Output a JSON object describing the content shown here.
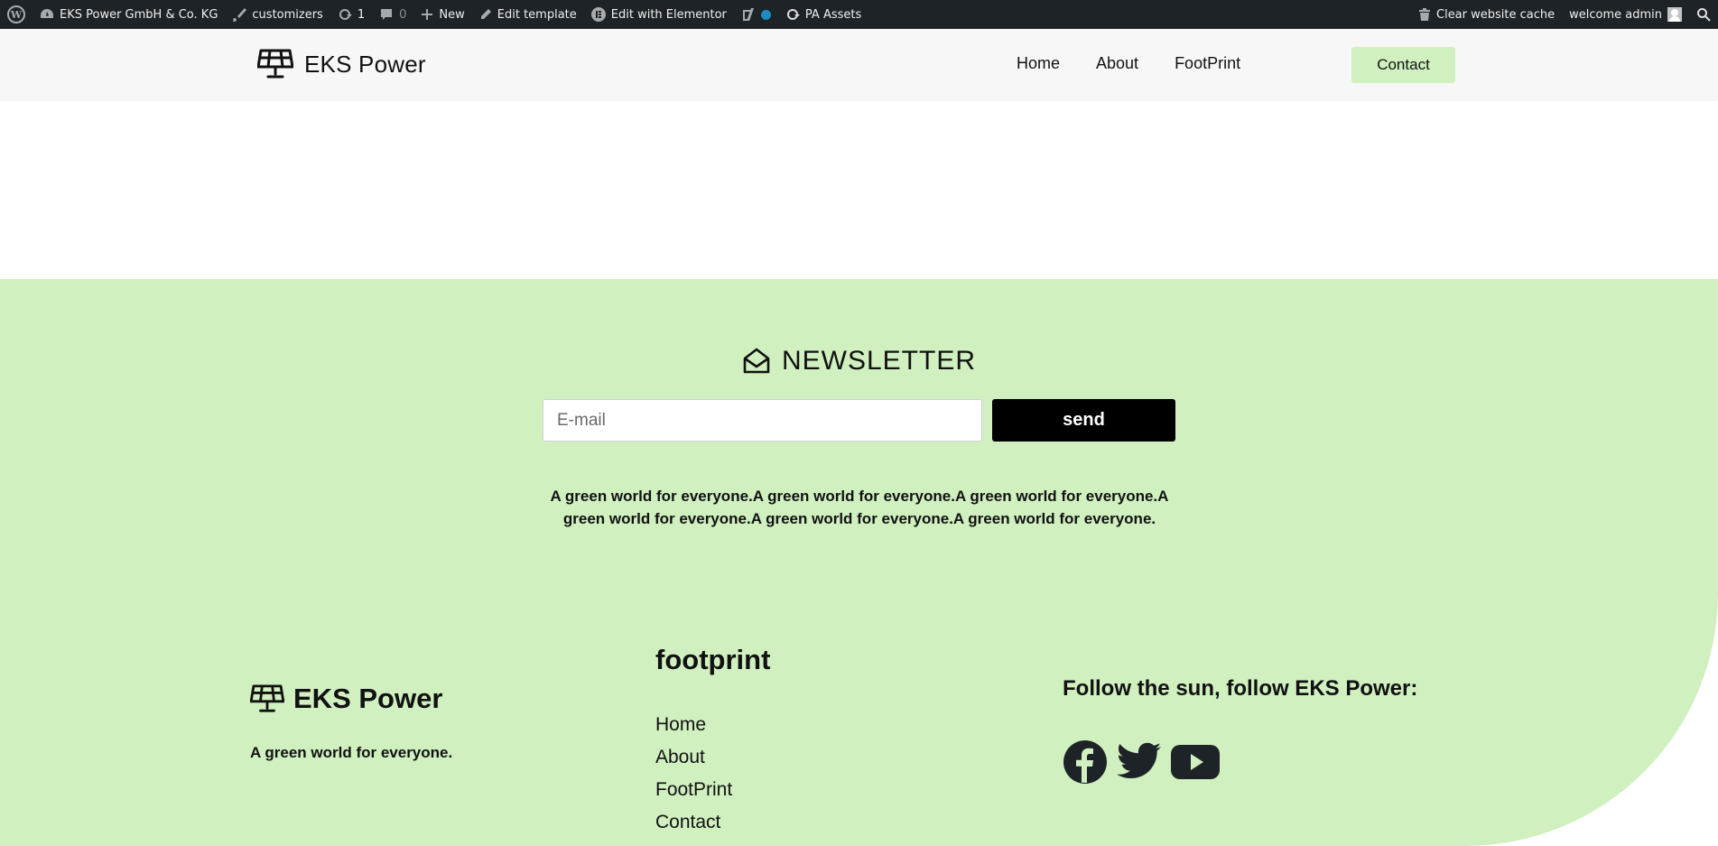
{
  "admin_bar": {
    "site_name": "EKS Power GmbH & Co. KG",
    "customizers": "customizers",
    "updates_count": "1",
    "comments_count": "0",
    "new": "New",
    "edit_template": "Edit template",
    "edit_elementor": "Edit with Elementor",
    "pa_assets": "PA Assets",
    "clear_cache": "Clear website cache",
    "welcome": "welcome admin"
  },
  "header": {
    "brand": "EKS Power",
    "nav": [
      "Home",
      "About",
      "FootPrint"
    ],
    "contact": "Contact"
  },
  "newsletter": {
    "title": "NEWSLETTER",
    "email_placeholder": "E-mail",
    "send": "send",
    "text": "A green world for everyone.A green world for everyone.A green world for everyone.A green world for everyone.A green world for everyone.A green world for everyone."
  },
  "footer": {
    "brand": "EKS Power",
    "tagline": "A green world for everyone.",
    "column_title": "footprint",
    "links": [
      "Home",
      "About",
      "FootPrint",
      "Contact"
    ],
    "follow": "Follow the sun, follow EKS Power:",
    "socials": [
      "facebook-icon",
      "twitter-icon",
      "youtube-icon"
    ]
  },
  "colors": {
    "admin_bar": "#1d2327",
    "header_bg": "#f7f7f7",
    "accent_green": "#d0f0c0",
    "send_button": "#000000"
  }
}
